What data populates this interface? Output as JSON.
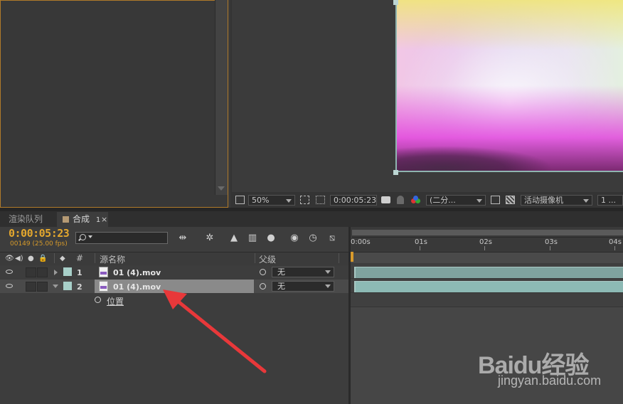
{
  "viewer": {
    "zoom": "50%",
    "timecode": "0:00:05:23",
    "resolution": "(二分...",
    "camera": "活动摄像机",
    "views": "1 ..."
  },
  "tabs": {
    "render_queue": "渲染队列",
    "comp": "合成",
    "comp_num": "1",
    "close": "×"
  },
  "timeline": {
    "current_time": "0:00:05:23",
    "frame_info": "00149 (25.00 fps)",
    "columns": {
      "num": "#",
      "source_name": "源名称",
      "parent": "父级"
    },
    "layers": [
      {
        "num": "1",
        "name": "01 (4).mov",
        "parent": "无"
      },
      {
        "num": "2",
        "name": "01 (4).mov",
        "parent": "无"
      }
    ],
    "property": "位置",
    "ruler": [
      "0:00s",
      "01s",
      "02s",
      "03s",
      "04s"
    ]
  },
  "watermark": {
    "brand": "Baidu经验",
    "url": "jingyan.baidu.com"
  },
  "colors": {
    "accent_orange": "#e3a72e",
    "layer_bar": "#7fa39f",
    "arrow": "#e8383a"
  }
}
